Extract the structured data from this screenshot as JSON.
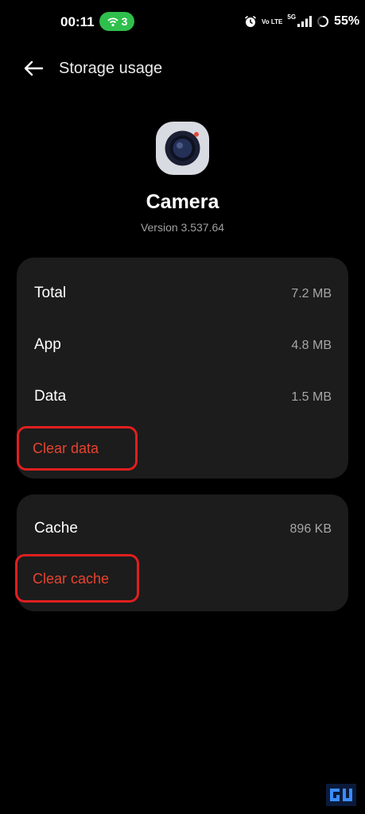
{
  "status_bar": {
    "time": "00:11",
    "hotspot_count": "3",
    "network_volte": "Vo LTE",
    "network_type": "5G",
    "battery_percent": "55%"
  },
  "header": {
    "title": "Storage usage",
    "back_icon": "arrow-left-icon"
  },
  "app": {
    "name": "Camera",
    "version": "Version 3.537.64",
    "icon": "camera-app-icon"
  },
  "storage": {
    "rows": [
      {
        "label": "Total",
        "value": "7.2 MB"
      },
      {
        "label": "App",
        "value": "4.8 MB"
      },
      {
        "label": "Data",
        "value": "1.5 MB"
      }
    ],
    "clear_data_label": "Clear data"
  },
  "cache": {
    "label": "Cache",
    "value": "896 KB",
    "clear_cache_label": "Clear cache"
  },
  "colors": {
    "background": "#000000",
    "card": "#1c1c1c",
    "action": "#e8432f",
    "highlight": "#e01f1f",
    "hotspot": "#2fbf4c"
  }
}
